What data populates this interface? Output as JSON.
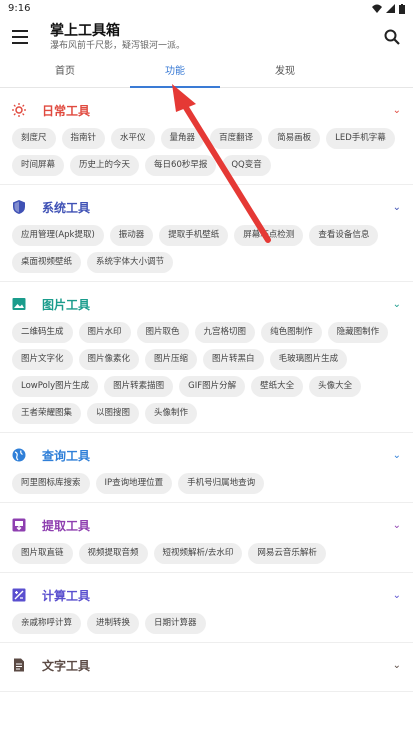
{
  "status": {
    "time": "9:16"
  },
  "appbar": {
    "title": "掌上工具箱",
    "subtitle": "瀑布风前千尺影，疑泻银河一派。"
  },
  "tabs": [
    {
      "label": "首页"
    },
    {
      "label": "功能"
    },
    {
      "label": "发现"
    }
  ],
  "sections": [
    {
      "title": "日常工具",
      "color": "#e04a3f",
      "icon": "sun-icon",
      "items": [
        "刻度尺",
        "指南针",
        "水平仪",
        "量角器",
        "百度翻译",
        "简易画板",
        "LED手机字幕",
        "时间屏幕",
        "历史上的今天",
        "每日60秒早报",
        "QQ变音"
      ]
    },
    {
      "title": "系统工具",
      "color": "#3f51b5",
      "icon": "shield-icon",
      "items": [
        "应用管理(Apk提取)",
        "振动器",
        "提取手机壁纸",
        "屏幕坏点检测",
        "查看设备信息",
        "桌面视频壁纸",
        "系统字体大小调节"
      ]
    },
    {
      "title": "图片工具",
      "color": "#1a9c8c",
      "icon": "image-icon",
      "items": [
        "二维码生成",
        "图片水印",
        "图片取色",
        "九宫格切图",
        "纯色图制作",
        "隐藏图制作",
        "图片文字化",
        "图片像素化",
        "图片压缩",
        "图片转黑白",
        "毛玻璃图片生成",
        "LowPoly图片生成",
        "图片转素描图",
        "GIF图片分解",
        "壁纸大全",
        "头像大全",
        "王者荣耀图集",
        "以图搜图",
        "头像制作"
      ]
    },
    {
      "title": "查询工具",
      "color": "#2f7fd8",
      "icon": "globe-icon",
      "items": [
        "阿里图标库搜索",
        "IP查询地理位置",
        "手机号归属地查询"
      ]
    },
    {
      "title": "提取工具",
      "color": "#8e3fb0",
      "icon": "extract-icon",
      "items": [
        "图片取直链",
        "视频提取音频",
        "短视频解析/去水印",
        "网易云音乐解析"
      ]
    },
    {
      "title": "计算工具",
      "color": "#5a4fcf",
      "icon": "calc-icon",
      "items": [
        "亲戚称呼计算",
        "进制转换",
        "日期计算器"
      ]
    },
    {
      "title": "文字工具",
      "color": "#5b4a44",
      "icon": "doc-icon",
      "items": []
    }
  ]
}
